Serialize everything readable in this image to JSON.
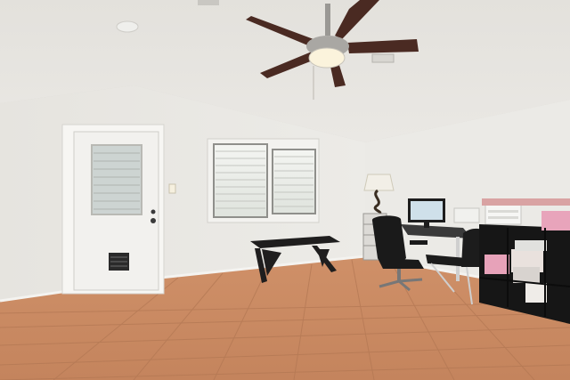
{
  "scene": {
    "kind": "room-interior-photo",
    "room": "home office",
    "objects": [
      "ceiling-fan-with-light",
      "white-exterior-door-with-window",
      "door-vent-grille",
      "double-window-with-blinds",
      "black-bench",
      "table-lamp",
      "computer-monitor",
      "desk",
      "office-chair",
      "black-cube-shelf",
      "storage-bins",
      "terracotta-tile-floor"
    ]
  },
  "colors": {
    "wall": "#e8e6e1",
    "ceiling": "#e4e2dd",
    "floor": "#c98b63",
    "floor_grout": "#b57a55",
    "door": "#f2f1ee",
    "furniture_dark": "#1f1e1e",
    "fan_blade": "#4a2a22",
    "pink_bin": "#e7a2b9"
  }
}
